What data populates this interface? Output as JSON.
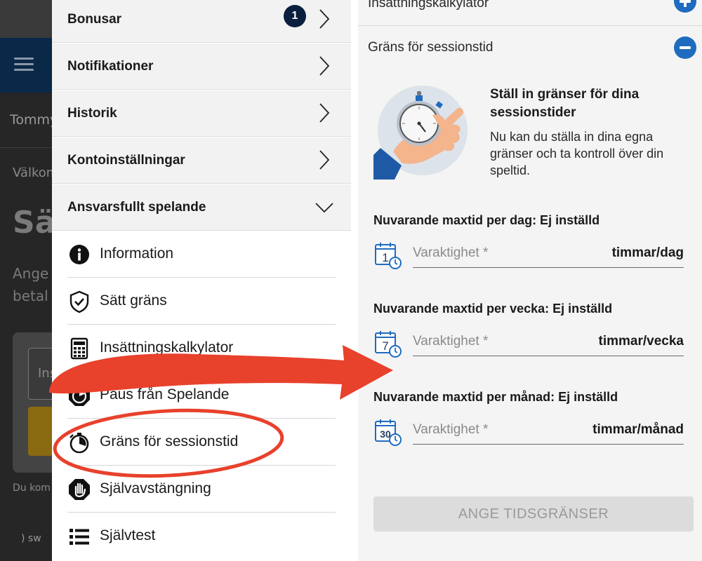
{
  "background_app": {
    "user_name": "Tommy",
    "welcome": "Välkom",
    "heading": "Sä",
    "line1": "Ange",
    "line2": "betal",
    "input_text": "Ins",
    "footer": "Du kom",
    "logo_text": "sw"
  },
  "menu": {
    "rows": [
      {
        "label": "Bonusar",
        "badge": "1"
      },
      {
        "label": "Notifikationer"
      },
      {
        "label": "Historik"
      },
      {
        "label": "Kontoinställningar"
      },
      {
        "label": "Ansvarsfullt spelande"
      }
    ],
    "sub_items": [
      {
        "label": "Information",
        "icon": "info-icon"
      },
      {
        "label": "Sätt gräns",
        "icon": "shield-check-icon"
      },
      {
        "label": "Insättningskalkylator",
        "icon": "calculator-icon"
      },
      {
        "label": "Paus från Spelande",
        "icon": "pause-timer-icon"
      },
      {
        "label": "Gräns för sessionstid",
        "icon": "stopwatch-icon"
      },
      {
        "label": "Självavstängning",
        "icon": "hand-stop-icon"
      },
      {
        "label": "Självtest",
        "icon": "list-icon"
      }
    ]
  },
  "panel": {
    "prev_section": "Insättningskalkylator",
    "section_title": "Gräns för sessionstid",
    "promo_title": "Ställ in gränser för dina sessionstider",
    "promo_text": "Nu kan du ställa in dina egna gränser och ta kontroll över din speltid.",
    "limits": [
      {
        "title": "Nuvarande maxtid per dag: Ej inställd",
        "placeholder": "Varaktighet *",
        "unit": "timmar/dag",
        "calendar_number": "1"
      },
      {
        "title": "Nuvarande maxtid per vecka: Ej inställd",
        "placeholder": "Varaktighet *",
        "unit": "timmar/vecka",
        "calendar_number": "7"
      },
      {
        "title": "Nuvarande maxtid per månad: Ej inställd",
        "placeholder": "Varaktighet *",
        "unit": "timmar/månad",
        "calendar_number": "30"
      }
    ],
    "submit_label": "ANGE TIDSGRÄNSER"
  },
  "colors": {
    "accent_blue": "#1f6bbf",
    "dark_navy": "#0a1f3d",
    "annotation_red": "#e8412c"
  }
}
